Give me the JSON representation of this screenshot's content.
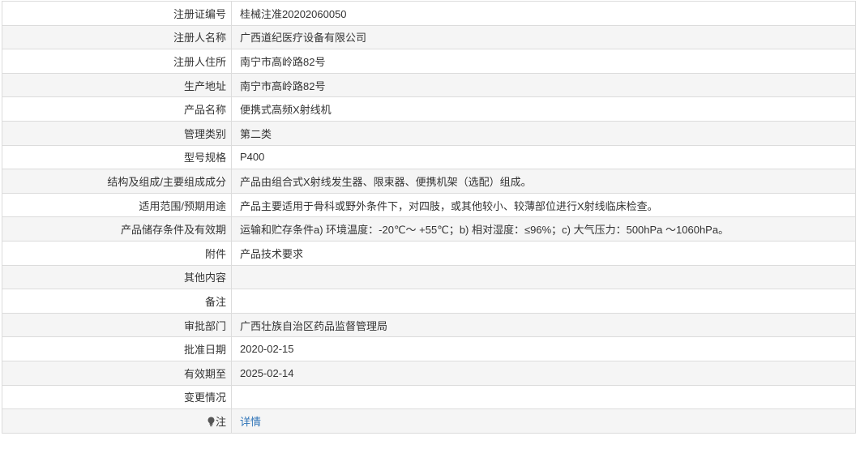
{
  "rows": [
    {
      "label": "注册证编号",
      "value": "桂械注准20202060050"
    },
    {
      "label": "注册人名称",
      "value": "广西道纪医疗设备有限公司"
    },
    {
      "label": "注册人住所",
      "value": "南宁市高岭路82号"
    },
    {
      "label": "生产地址",
      "value": "南宁市高岭路82号"
    },
    {
      "label": "产品名称",
      "value": "便携式高频X射线机"
    },
    {
      "label": "管理类别",
      "value": "第二类"
    },
    {
      "label": "型号规格",
      "value": "P400"
    },
    {
      "label": "结构及组成/主要组成成分",
      "value": "产品由组合式X射线发生器、限束器、便携机架（选配）组成。"
    },
    {
      "label": "适用范围/预期用途",
      "value": "产品主要适用于骨科或野外条件下，对四肢，或其他较小、较薄部位进行X射线临床检查。"
    },
    {
      "label": "产品储存条件及有效期",
      "value": "运输和贮存条件a) 环境温度：-20℃～ +55℃；b) 相对湿度：≤96%；c) 大气压力：500hPa ～1060hPa。"
    },
    {
      "label": "附件",
      "value": "产品技术要求"
    },
    {
      "label": "其他内容",
      "value": ""
    },
    {
      "label": "备注",
      "value": ""
    },
    {
      "label": "审批部门",
      "value": "广西壮族自治区药品监督管理局"
    },
    {
      "label": "批准日期",
      "value": "2020-02-15"
    },
    {
      "label": "有效期至",
      "value": "2025-02-14"
    },
    {
      "label": "变更情况",
      "value": ""
    }
  ],
  "note": {
    "label": "注",
    "link_text": "详情",
    "icon": "lightbulb-icon"
  },
  "colors": {
    "border": "#dcdcdc",
    "stripe": "#f5f5f5",
    "text": "#333333",
    "link": "#2f74b8"
  }
}
